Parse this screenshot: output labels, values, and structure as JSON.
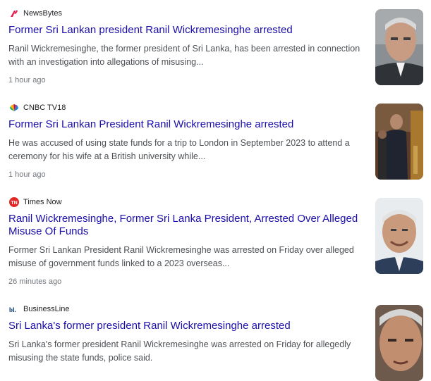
{
  "articles": [
    {
      "source": "NewsBytes",
      "source_icon": "newsbytes-logo-icon",
      "title": "Former Sri Lankan president Ranil Wickremesinghe arrested",
      "snippet": "Ranil Wickremesinghe, the former president of Sri Lanka, has been arrested in connection with an investigation into allegations of misusing...",
      "time": "1 hour ago",
      "thumbnail": "portrait-photo"
    },
    {
      "source": "CNBC TV18",
      "source_icon": "cnbc-peacock-logo-icon",
      "title": "Former Sri Lankan President Ranil Wickremesinghe arrested",
      "snippet": "He was accused of using state funds for a trip to London in September 2023 to attend a ceremony for his wife at a British university while...",
      "time": "1 hour ago",
      "thumbnail": "ceremony-photo"
    },
    {
      "source": "Times Now",
      "source_icon": "times-now-logo-icon",
      "title": "Ranil Wickremesinghe, Former Sri Lanka President, Arrested Over Alleged Misuse Of Funds",
      "snippet": "Former Sri Lankan President Ranil Wickremesinghe was arrested on Friday over alleged misuse of government funds linked to a 2023 overseas...",
      "time": "26 minutes ago",
      "thumbnail": "smiling-portrait-photo"
    },
    {
      "source": "BusinessLine",
      "source_icon": "businessline-logo-icon",
      "title": "Sri Lanka's former president Ranil Wickremesinghe arrested",
      "snippet": "Sri Lanka's former president Ranil Wickremesinghe was arrested on Friday for allegedly misusing the state funds, police said.",
      "time": "",
      "thumbnail": "closeup-portrait-photo"
    }
  ],
  "colors": {
    "title_link": "#1a0dab",
    "snippet": "#4d5156",
    "time": "#70757a"
  }
}
